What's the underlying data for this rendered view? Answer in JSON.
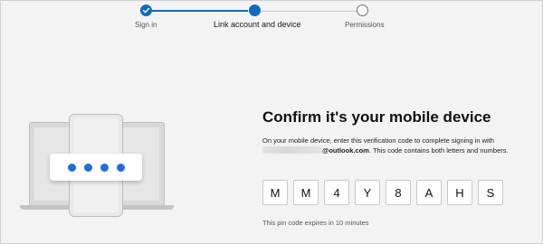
{
  "stepper": {
    "steps": [
      {
        "label": "Sign in",
        "state": "done"
      },
      {
        "label": "Link account and device",
        "state": "current"
      },
      {
        "label": "Permissions",
        "state": "todo"
      }
    ]
  },
  "colors": {
    "accent": "#0f6cbd",
    "background": "#f3f3f3",
    "pin_dot": "#1e6fd9"
  },
  "illustration": {
    "icons": [
      "laptop-icon",
      "phone-icon",
      "pin-entry-icon"
    ],
    "pin_dot_count": 4
  },
  "main": {
    "title": "Confirm it's your mobile device",
    "description_line1": "On your mobile device, enter this verification code to complete signing in with",
    "email_domain": "@outlook.com",
    "description_line2_suffix": ". This code contains both letters and numbers.",
    "code": [
      "M",
      "M",
      "4",
      "Y",
      "8",
      "A",
      "H",
      "S"
    ],
    "expiry": "This pin code expires in 10 minutes"
  }
}
